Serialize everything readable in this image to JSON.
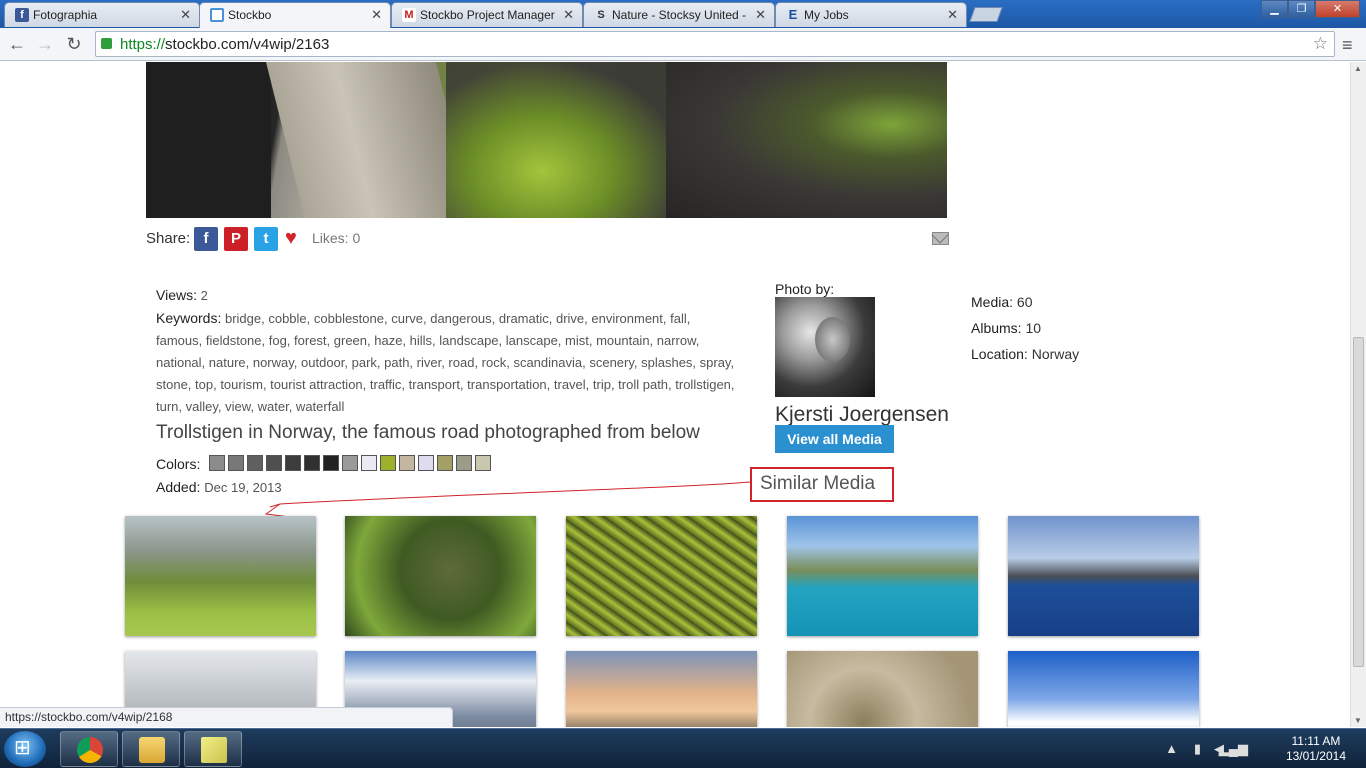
{
  "browser": {
    "tabs": [
      {
        "label": "Fotographia",
        "icon": "facebook-icon",
        "active": false
      },
      {
        "label": "Stockbo",
        "icon": "stockbo-icon",
        "active": true
      },
      {
        "label": "Stockbo Project Manager",
        "icon": "gmail-icon",
        "active": false
      },
      {
        "label": "Nature - Stocksy United -",
        "icon": "stocksy-icon",
        "active": false
      },
      {
        "label": "My Jobs",
        "icon": "elance-icon",
        "active": false
      }
    ],
    "url_scheme": "https://",
    "url_rest": "stockbo.com/v4wip/2163",
    "status_url": "https://stockbo.com/v4wip/2168"
  },
  "share": {
    "label": "Share:",
    "likes": "Likes: 0",
    "buttons": [
      "facebook",
      "pinterest",
      "twitter"
    ],
    "colors": {
      "facebook": "#3b5998",
      "pinterest": "#cb2027",
      "twitter": "#2aa3e6",
      "heart": "#d2232a"
    }
  },
  "details": {
    "views_label": "Views:",
    "views": "2",
    "keywords_label": "Keywords:",
    "keywords": "bridge, cobble, cobblestone, curve, dangerous, dramatic, drive, environment, fall, famous, fieldstone, fog, forest, green, haze, hills, landscape, lanscape, mist, mountain, narrow, national, nature, norway, outdoor, park, path, river, road, rock, scandinavia, scenery, splashes, spray, stone, top, tourism, tourist attraction, traffic, transport, transportation, travel, trip, troll path, trollstigen, turn, valley, view, water, waterfall",
    "title": "Trollstigen in Norway, the famous road photographed from below",
    "colors_label": "Colors:",
    "colors": [
      "#8c8c8c",
      "#787878",
      "#5f5f5f",
      "#4f4f4f",
      "#3c3c3c",
      "#303030",
      "#232323",
      "#9a9a9a",
      "#ebeaf5",
      "#9db12c",
      "#c3b7a2",
      "#dedcee",
      "#a2a064",
      "#9a9b89",
      "#c7c8ae"
    ],
    "added_label": "Added:",
    "added": "Dec 19, 2013"
  },
  "photographer": {
    "label": "Photo by:",
    "name": "Kjersti Joergensen",
    "button": "View all Media",
    "media_label": "Media:",
    "media": "60",
    "albums_label": "Albums:",
    "albums": "10",
    "location_label": "Location:",
    "location": "Norway"
  },
  "similar": {
    "heading": "Similar Media"
  },
  "taskbar": {
    "time": "11:11 AM",
    "date": "13/01/2014"
  }
}
